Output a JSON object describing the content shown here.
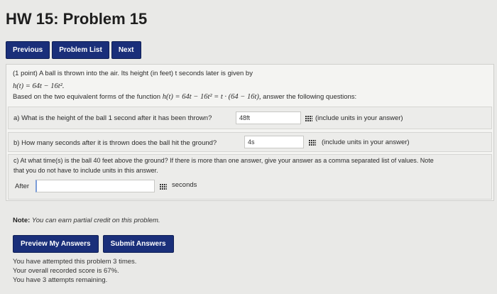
{
  "page": {
    "title": "HW 15: Problem 15"
  },
  "nav": {
    "previous": "Previous",
    "problem_list": "Problem List",
    "next": "Next"
  },
  "problem": {
    "intro": "(1 point) A ball is thrown into the air. Its height (in feet) t seconds later is given by",
    "formula": "h(t) = 64t − 16t².",
    "equiv_prefix": "Based on the two equivalent forms of the function",
    "equiv_formula": "h(t) = 64t − 16t² = t · (64 − 16t),",
    "equiv_suffix": "answer the following questions:",
    "qa": {
      "label": "a) What is the height of the ball 1 second after it has been thrown?",
      "value": "48ft",
      "hint": "(include units in your answer)",
      "hint_icon": "equation-editor-icon"
    },
    "qb": {
      "label": "b) How many seconds after it is thrown does the ball hit the ground?",
      "value": "4s",
      "hint": "(include units in your answer)",
      "hint_icon": "equation-editor-icon"
    },
    "qc": {
      "line1": "c) At what time(s) is the ball 40 feet above the ground? If there is more than one answer, give your answer as a comma separated list of values. Note",
      "line2": "that you do not have to include units in this answer.",
      "after_label": "After",
      "value": "",
      "units": "seconds"
    }
  },
  "note": {
    "label": "Note:",
    "text": "You can earn partial credit on this problem."
  },
  "actions": {
    "preview": "Preview My Answers",
    "submit": "Submit Answers"
  },
  "status": {
    "attempts": "You have attempted this problem 3 times.",
    "score": "Your overall recorded score is 67%.",
    "remaining": "You have 3 attempts remaining."
  },
  "colors": {
    "button": "#1a2f7a",
    "background": "#e9e9e7",
    "panel": "#f4f4f2"
  }
}
